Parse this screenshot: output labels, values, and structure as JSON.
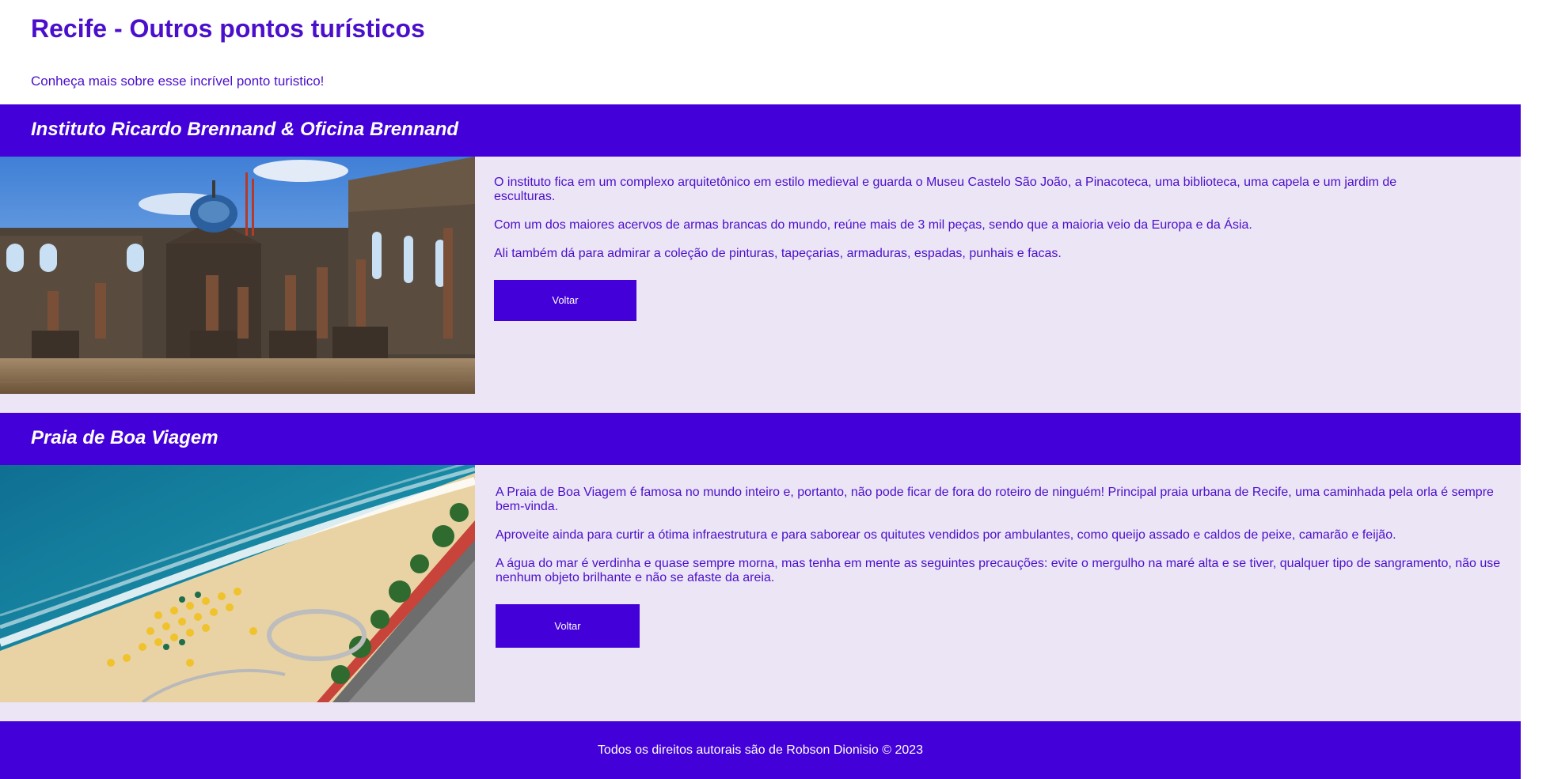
{
  "header": {
    "title": "Recife - Outros pontos turísticos",
    "subtitle": "Conheça mais sobre esse incrível ponto turistico!"
  },
  "sections": [
    {
      "title": "Instituto Ricardo Brennand & Oficina Brennand",
      "image_icon": "castle-photo",
      "paragraphs": [
        "O instituto fica em um complexo arquitetônico em estilo medieval e guarda o Museu Castelo São João, a Pinacoteca, uma biblioteca, uma capela e um jardim de esculturas.",
        "Com um dos maiores acervos de armas brancas do mundo, reúne mais de 3 mil peças, sendo que a maioria veio da Europa e da Ásia.",
        "Ali também dá para admirar a coleção de pinturas, tapeçarias, armaduras, espadas, punhais e facas."
      ],
      "button_label": "Voltar"
    },
    {
      "title": "Praia de Boa Viagem",
      "image_icon": "beach-photo",
      "paragraphs": [
        "A Praia de Boa Viagem é famosa no mundo inteiro e, portanto, não pode ficar de fora do roteiro de ninguém! Principal praia urbana de Recife, uma caminhada pela orla é sempre bem-vinda.",
        "Aproveite ainda para curtir a ótima infraestrutura e para saborear os quitutes vendidos por ambulantes, como queijo assado e caldos de peixe, camarão e feijão.",
        "A água do mar é verdinha e quase sempre morna, mas tenha em mente as seguintes precauções: evite o mergulho na maré alta e se tiver, qualquer tipo de sangramento, não use nenhum objeto brilhante e não se afaste da areia."
      ],
      "button_label": "Voltar"
    }
  ],
  "footer": {
    "text": "Todos os direitos autorais são de Robson Dionisio © 2023"
  },
  "colors": {
    "primary": "#4300d8",
    "text": "#4b0fcc",
    "section_bg": "#ece5f5",
    "white": "#ffffff"
  }
}
